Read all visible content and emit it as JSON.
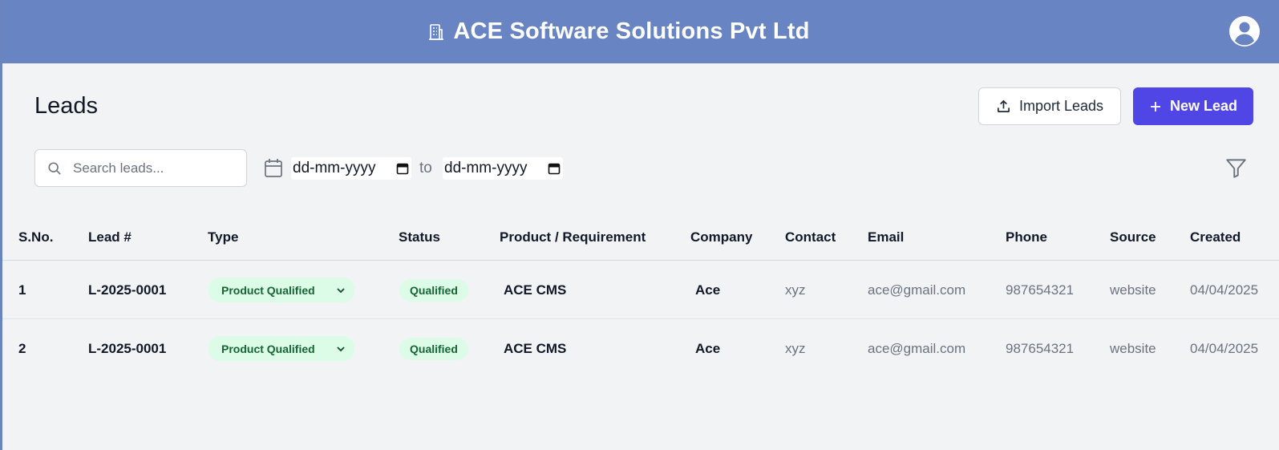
{
  "header": {
    "title": "ACE Software Solutions Pvt Ltd",
    "brand_icon": "building-icon",
    "avatar_icon": "user-circle-icon"
  },
  "page": {
    "title": "Leads"
  },
  "actions": {
    "import_label": "Import Leads",
    "import_icon": "upload-icon",
    "new_label": "New Lead",
    "new_icon": "plus-icon"
  },
  "filters": {
    "search_placeholder": "Search leads...",
    "date_from_placeholder": "dd-mm-yyyy",
    "date_to_placeholder": "dd-mm-yyyy",
    "to_label": "to"
  },
  "table": {
    "columns": [
      "S.No.",
      "Lead #",
      "Type",
      "Status",
      "Product / Requirement",
      "Company",
      "Contact",
      "Email",
      "Phone",
      "Source",
      "Created"
    ],
    "rows": [
      {
        "sno": "1",
        "lead": "L-2025-0001",
        "type": "Product Qualified",
        "status": "Qualified",
        "product": "ACE CMS",
        "company": "Ace",
        "contact": "xyz",
        "email": "ace@gmail.com",
        "phone": "987654321",
        "source": "website",
        "created": "04/04/2025"
      },
      {
        "sno": "2",
        "lead": "L-2025-0001",
        "type": "Product Qualified",
        "status": "Qualified",
        "product": "ACE CMS",
        "company": "Ace",
        "contact": "xyz",
        "email": "ace@gmail.com",
        "phone": "987654321",
        "source": "website",
        "created": "04/04/2025"
      }
    ]
  },
  "colors": {
    "header_bg": "#6984c2",
    "primary": "#4f46e5",
    "badge_bg": "#dcfce7",
    "badge_text": "#166534"
  }
}
